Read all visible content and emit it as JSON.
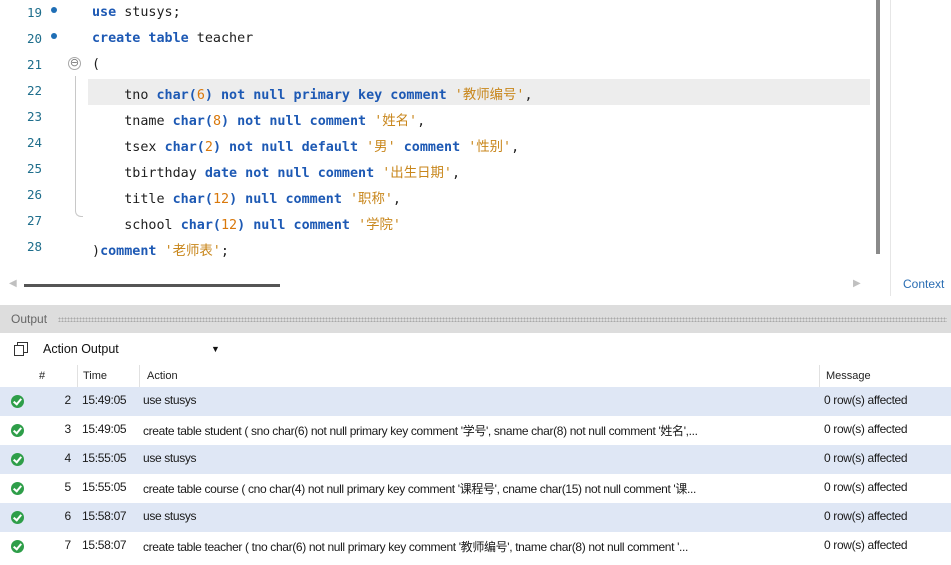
{
  "editor": {
    "lines": [
      {
        "num": "19",
        "marker": true,
        "tokens": [
          {
            "t": "use",
            "c": "kw"
          },
          {
            "t": " stusys;",
            "c": ""
          }
        ]
      },
      {
        "num": "20",
        "marker": true,
        "tokens": [
          {
            "t": "create table",
            "c": "kw"
          },
          {
            "t": " teacher",
            "c": ""
          }
        ]
      },
      {
        "num": "21",
        "fold": "⊖",
        "tokens": [
          {
            "t": "(",
            "c": ""
          }
        ]
      },
      {
        "num": "22",
        "current": true,
        "tokens": [
          {
            "t": "    tno ",
            "c": ""
          },
          {
            "t": "char(",
            "c": "kw"
          },
          {
            "t": "6",
            "c": "num"
          },
          {
            "t": ") not null primary key comment ",
            "c": "kw"
          },
          {
            "t": "'教师编号'",
            "c": "str"
          },
          {
            "t": ",",
            "c": ""
          }
        ]
      },
      {
        "num": "23",
        "tokens": [
          {
            "t": "    tname ",
            "c": ""
          },
          {
            "t": "char(",
            "c": "kw"
          },
          {
            "t": "8",
            "c": "num"
          },
          {
            "t": ") not null comment ",
            "c": "kw"
          },
          {
            "t": "'姓名'",
            "c": "str"
          },
          {
            "t": ",",
            "c": ""
          }
        ]
      },
      {
        "num": "24",
        "tokens": [
          {
            "t": "    tsex ",
            "c": ""
          },
          {
            "t": "char(",
            "c": "kw"
          },
          {
            "t": "2",
            "c": "num"
          },
          {
            "t": ") not null default ",
            "c": "kw"
          },
          {
            "t": "'男'",
            "c": "str"
          },
          {
            "t": " comment ",
            "c": "kw"
          },
          {
            "t": "'性别'",
            "c": "str"
          },
          {
            "t": ",",
            "c": ""
          }
        ]
      },
      {
        "num": "25",
        "tokens": [
          {
            "t": "    tbirthday ",
            "c": ""
          },
          {
            "t": "date not null comment ",
            "c": "kw"
          },
          {
            "t": "'出生日期'",
            "c": "str"
          },
          {
            "t": ",",
            "c": ""
          }
        ]
      },
      {
        "num": "26",
        "tokens": [
          {
            "t": "    title ",
            "c": ""
          },
          {
            "t": "char(",
            "c": "kw"
          },
          {
            "t": "12",
            "c": "num"
          },
          {
            "t": ") null comment ",
            "c": "kw"
          },
          {
            "t": "'职称'",
            "c": "str"
          },
          {
            "t": ",",
            "c": ""
          }
        ]
      },
      {
        "num": "27",
        "tokens": [
          {
            "t": "    school ",
            "c": ""
          },
          {
            "t": "char(",
            "c": "kw"
          },
          {
            "t": "12",
            "c": "num"
          },
          {
            "t": ") null comment ",
            "c": "kw"
          },
          {
            "t": "'学院'",
            "c": "str"
          }
        ]
      },
      {
        "num": "28",
        "tokens": [
          {
            "t": ")",
            "c": ""
          },
          {
            "t": "comment ",
            "c": "kw"
          },
          {
            "t": "'老师表'",
            "c": "str"
          },
          {
            "t": ";",
            "c": ""
          }
        ]
      }
    ]
  },
  "right_pane": {
    "context_tab": "Context"
  },
  "output": {
    "title": "Output",
    "type_select": "Action Output",
    "columns": {
      "num": "#",
      "time": "Time",
      "action": "Action",
      "message": "Message"
    },
    "rows": [
      {
        "num": "2",
        "time": "15:49:05",
        "action": "use stusys",
        "message": "0 row(s) affected"
      },
      {
        "num": "3",
        "time": "15:49:05",
        "action": "create table student ( sno char(6) not null primary key comment '学号',    sname char(8) not null comment '姓名',...",
        "message": "0 row(s) affected"
      },
      {
        "num": "4",
        "time": "15:55:05",
        "action": "use stusys",
        "message": "0 row(s) affected"
      },
      {
        "num": "5",
        "time": "15:55:05",
        "action": "create table course ( cno char(4) not null primary key comment '课程号',    cname char(15) not null comment '课...",
        "message": "0 row(s) affected"
      },
      {
        "num": "6",
        "time": "15:58:07",
        "action": "use stusys",
        "message": "0 row(s) affected"
      },
      {
        "num": "7",
        "time": "15:58:07",
        "action": "create table teacher ( tno char(6) not null primary key comment '教师编号',    tname char(8) not null comment '...",
        "message": "0 row(s) affected"
      }
    ]
  },
  "colors": {
    "keyword": "#1d59b4",
    "string": "#c8861b",
    "number": "#d9780b",
    "success": "#2e9e49",
    "row_alt": "#dfe7f5"
  }
}
